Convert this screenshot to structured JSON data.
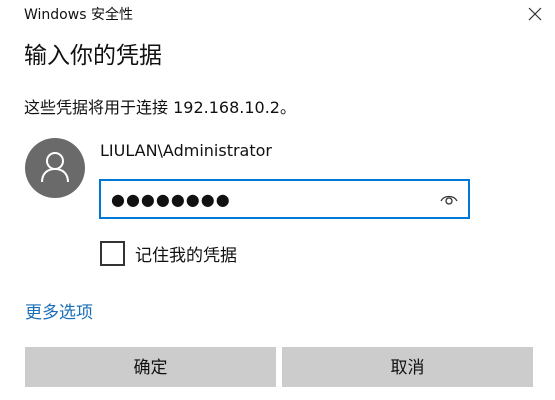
{
  "window": {
    "title": "Windows 安全性",
    "close_icon": "close-icon"
  },
  "dialog": {
    "heading": "输入你的凭据",
    "description": "这些凭据将用于连接 192.168.10.2。"
  },
  "account": {
    "avatar_icon": "user-avatar-icon",
    "username": "LIULAN\\Administrator"
  },
  "password": {
    "value": "●●●●●●●●",
    "reveal_icon": "eye-icon",
    "border_color": "#0078d7"
  },
  "remember": {
    "label": "记住我的凭据",
    "checked": false
  },
  "links": {
    "more_options": "更多选项",
    "link_color": "#1a6fb8"
  },
  "buttons": {
    "ok": "确定",
    "cancel": "取消",
    "background": "#cccccc"
  }
}
